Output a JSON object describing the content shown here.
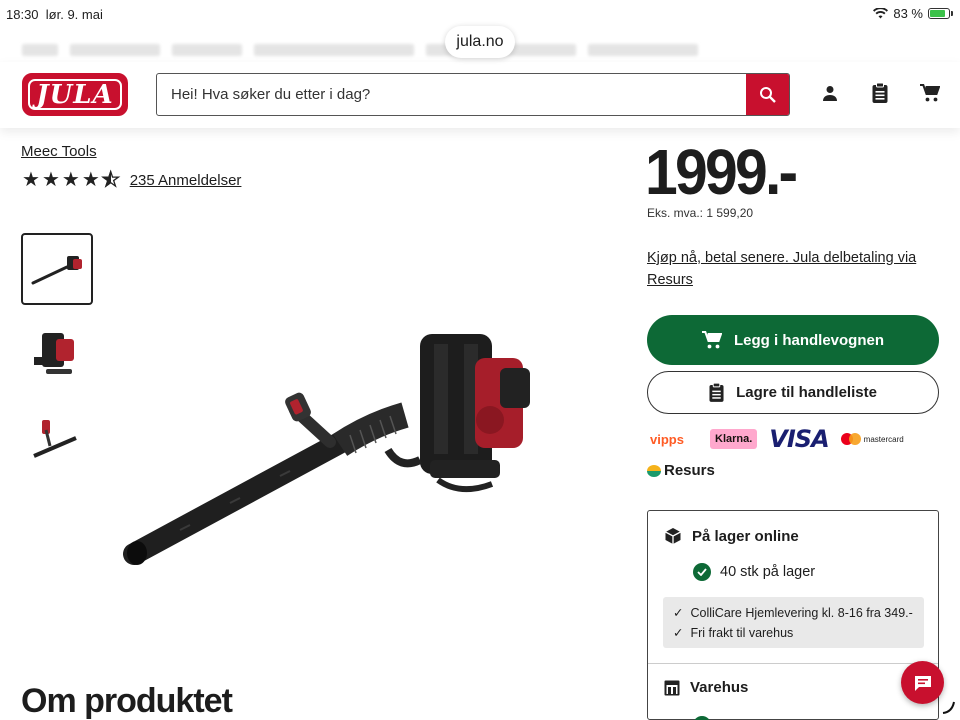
{
  "status_bar": {
    "time": "18:30",
    "date": "lør. 9. mai",
    "battery": "83 %"
  },
  "browser": {
    "url": "jula.no"
  },
  "header": {
    "logo_text": "JULA",
    "search_placeholder": "Hei! Hva søker du etter i dag?"
  },
  "product": {
    "brand": "Meec Tools",
    "rating": 4.5,
    "reviews": "235 Anmeldelser",
    "price": "1999.-",
    "ex_vat": "Eks. mva.: 1 599,20",
    "pay_later": "Kjøp nå, betal senere. Jula delbetaling via Resurs",
    "add_to_cart": "Legg i handlevognen",
    "save_list": "Lagre til handleliste",
    "about_heading": "Om produktet"
  },
  "payments": {
    "vipps": "vipps",
    "klarna": "Klarna.",
    "visa": "VISA",
    "mastercard": "mastercard",
    "resurs": "Resurs"
  },
  "stock": {
    "online_title": "På lager online",
    "online_qty": "40 stk på lager",
    "delivery_1": "ColliCare Hjemlevering kl. 8-16 fra 349.-",
    "delivery_2": "Fri frakt til varehus",
    "store_title": "Varehus"
  },
  "colors": {
    "brand_red": "#c8102e",
    "cta_green": "#0d6936"
  }
}
